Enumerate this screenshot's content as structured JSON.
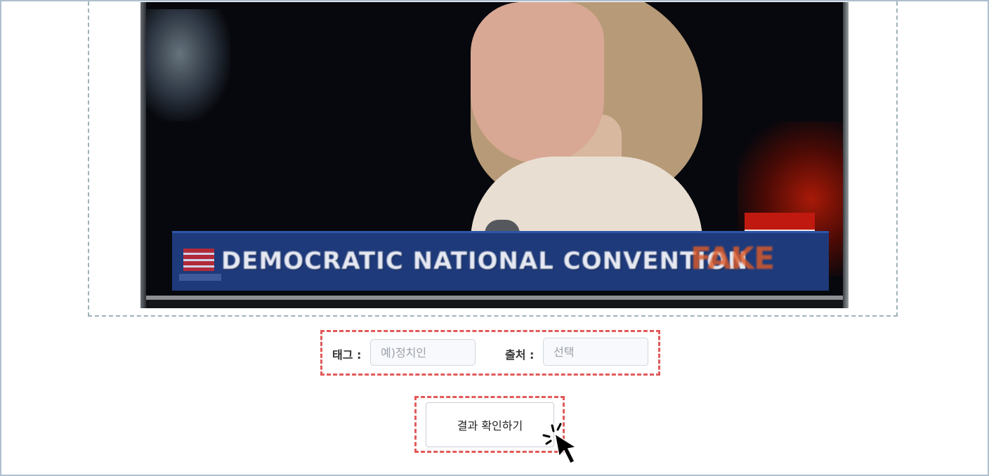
{
  "video": {
    "headline": "DEMOCRATIC NATIONAL CONVENTION",
    "watermark": "FAKE"
  },
  "form": {
    "tag_label": "태그 :",
    "tag_placeholder": "예)정치인",
    "source_label": "출처 :",
    "source_placeholder": "선택"
  },
  "actions": {
    "confirm_label": "결과 확인하기"
  },
  "colors": {
    "highlight_dash": "#e15a5a",
    "frame_border": "#aebfcf"
  },
  "icons": {
    "cursor": "click-cursor-icon"
  }
}
